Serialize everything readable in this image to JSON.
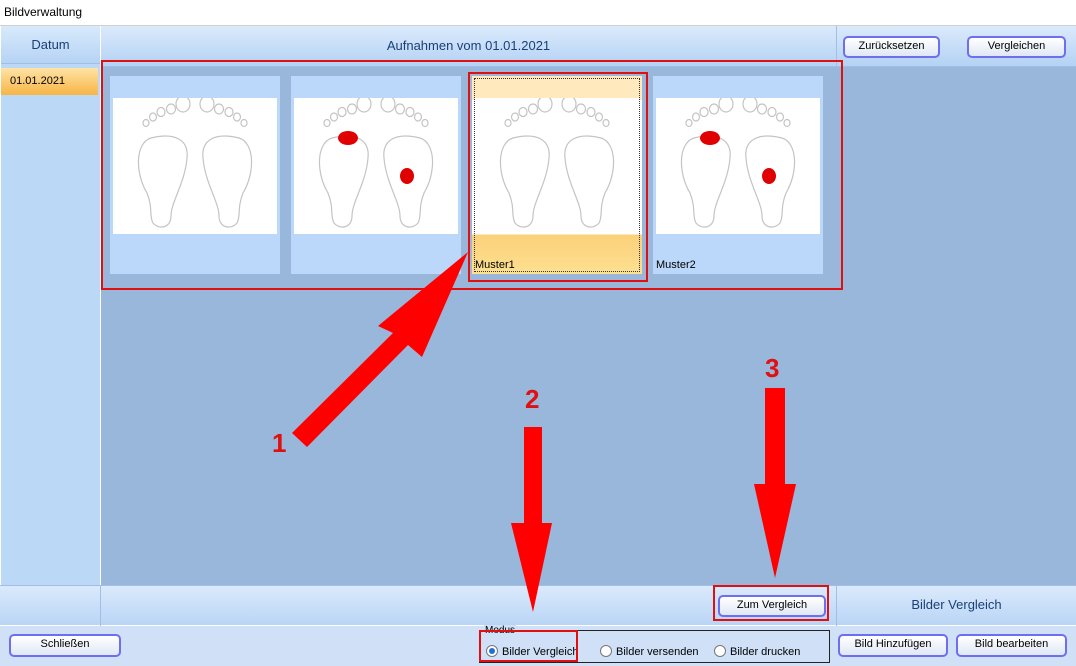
{
  "window": {
    "title": "Bildverwaltung"
  },
  "sidebar": {
    "header": "Datum",
    "dates": [
      "01.01.2021"
    ]
  },
  "header": {
    "title": "Aufnahmen vom 01.01.2021",
    "reset_label": "Zurücksetzen",
    "compare_label": "Vergleichen"
  },
  "images": [
    {
      "label": "",
      "marks": false,
      "selected": false
    },
    {
      "label": "",
      "marks": true,
      "selected": false
    },
    {
      "label": "Muster1",
      "marks": false,
      "selected": true
    },
    {
      "label": "Muster2",
      "marks": true,
      "selected": false
    }
  ],
  "bottom": {
    "to_compare_label": "Zum Vergleich",
    "mode_title": "Bilder Vergleich"
  },
  "footer": {
    "close_label": "Schließen",
    "modus_label": "Modus",
    "modes": [
      "Bilder Vergleich",
      "Bilder versenden",
      "Bilder drucken"
    ],
    "selected_mode": "Bilder Vergleich",
    "add_label": "Bild Hinzufügen",
    "edit_label": "Bild bearbeiten"
  },
  "annotations": {
    "step1": "1",
    "step2": "2",
    "step3": "3"
  },
  "colors": {
    "annotation": "#e01010",
    "button_border": "#6e6ef0",
    "selected": "#fbd07a",
    "content_bg": "#99b6db"
  }
}
